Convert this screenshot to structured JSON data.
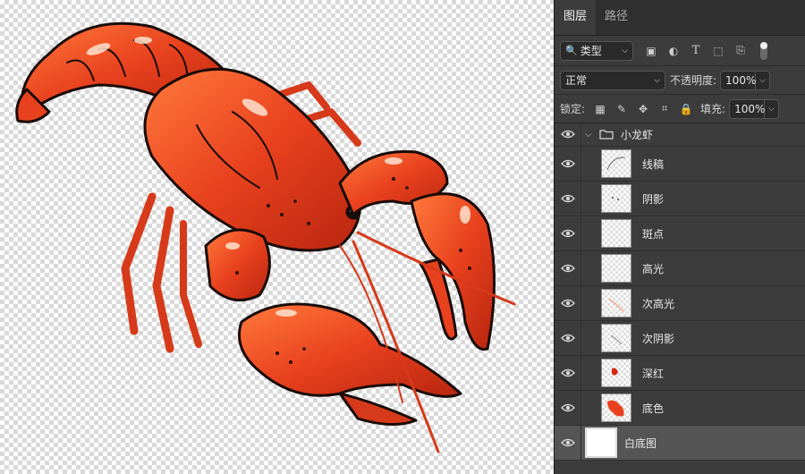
{
  "tabs": [
    {
      "label": "图层",
      "active": true
    },
    {
      "label": "路径",
      "active": false
    }
  ],
  "filter": {
    "kind_label": "类型"
  },
  "blend": {
    "mode": "正常",
    "opacity_label": "不透明度:",
    "opacity_value": "100%"
  },
  "lock": {
    "label": "锁定:",
    "fill_label": "填充:",
    "fill_value": "100%"
  },
  "group": {
    "name": "小龙虾"
  },
  "layers": [
    {
      "name": "线稿"
    },
    {
      "name": "阴影"
    },
    {
      "name": "斑点"
    },
    {
      "name": "高光"
    },
    {
      "name": "次高光"
    },
    {
      "name": "次阴影"
    },
    {
      "name": "深红"
    },
    {
      "name": "底色"
    }
  ],
  "background_layer": {
    "name": "白底图"
  },
  "colors": {
    "accent": "#e8411e",
    "panel_bg": "#3c3c3c",
    "selected": "#555555"
  }
}
